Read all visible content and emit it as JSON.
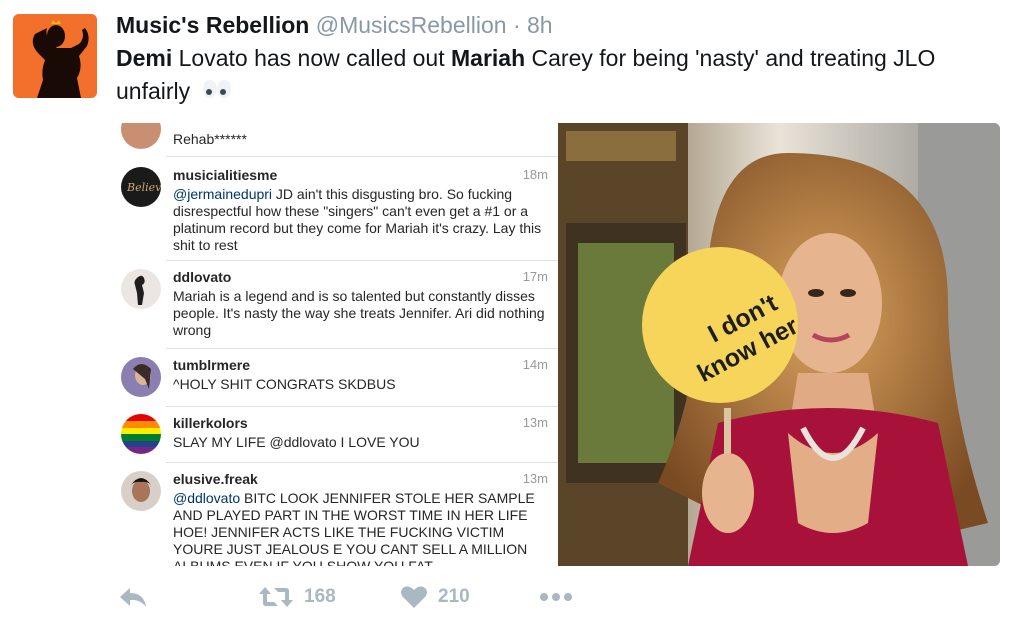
{
  "tweet": {
    "author_name": "Music's Rebellion",
    "handle": "@MusicsRebellion",
    "separator": "·",
    "time": "8h",
    "text_part1": "Demi",
    "text_part2": " Lovato has now called out ",
    "text_part3": "Mariah",
    "text_part4": " Carey for being 'nasty' and treating JLO unfairly",
    "emoji": "eyes-emoji"
  },
  "comments": [
    {
      "user": "",
      "time": "",
      "text": "Rehab******",
      "avatar_color": "#c98f73"
    },
    {
      "user": "musicialitiesme",
      "time": "18m",
      "mention": "@jermainedupri",
      "text": " JD ain't this disgusting bro. So fucking disrespectful how these \"singers\" can't even get a #1 or a platinum record but they come for Mariah it's crazy. Lay this shit to rest",
      "avatar_color": "#1a1a1a"
    },
    {
      "user": "ddlovato",
      "time": "17m",
      "mention": "",
      "text": "Mariah is a legend and is so talented but constantly disses people. It's nasty the way she treats Jennifer. Ari did nothing wrong",
      "avatar_color": "#e8e0dc"
    },
    {
      "user": "tumblrmere",
      "time": "14m",
      "mention": "",
      "text": "^HOLY SHIT CONGRATS SKDBUS",
      "avatar_color": "#8a7fb0"
    },
    {
      "user": "killerkolors",
      "time": "13m",
      "mention": "",
      "text": "SLAY MY LIFE @ddlovato I LOVE YOU",
      "avatar_color": "rainbow"
    },
    {
      "user": "elusive.freak",
      "time": "13m",
      "mention": "@ddlovato",
      "text": " BITC LOOK JENNIFER STOLE HER SAMPLE AND PLAYED  PART IN THE WORST TIME IN HER LIFE HOE! JENNIFER ACTS LIKE THE FUCKING VICTIM YOURE JUST JEALOUS E YOU CANT SELL A MILLION ALBUMS EVEN IF YOU SHOW YOU FAT",
      "avatar_color": "#6b4a3a"
    }
  ],
  "photo": {
    "sign_line1": "I don't",
    "sign_line2": "know her",
    "sign_color": "#f7d55a",
    "dress_color": "#a8123a"
  },
  "actions": {
    "reply_icon": "reply-icon",
    "retweet_icon": "retweet-icon",
    "retweet_count": "168",
    "like_icon": "heart-icon",
    "like_count": "210",
    "more_icon": "more-icon"
  }
}
